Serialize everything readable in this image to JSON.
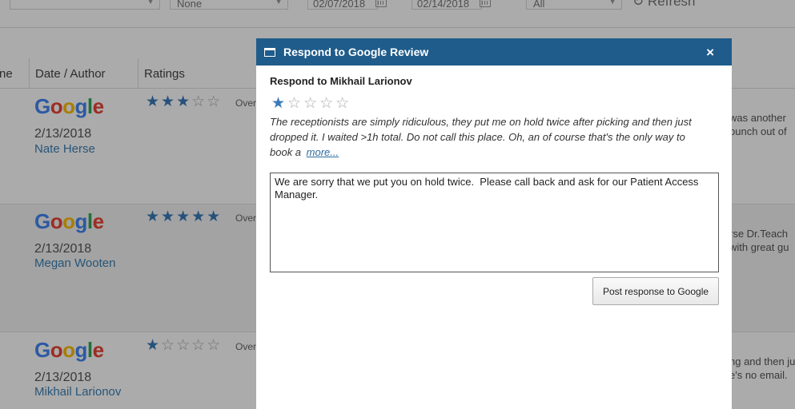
{
  "filters": {
    "select_one": "None",
    "date_from": "02/07/2018",
    "date_to": "02/14/2018",
    "select_two": "All",
    "refresh_label": "Refresh"
  },
  "table": {
    "headers": [
      "ne",
      "Date / Author",
      "Ratings"
    ],
    "rows": [
      {
        "date": "2/13/2018",
        "author": "Nate Herse",
        "stars": "★★★☆☆",
        "over": "Over",
        "text_line1": "was another",
        "text_line2": "bunch out of"
      },
      {
        "date": "2/13/2018",
        "author": "Megan Wooten",
        "stars": "★★★★★",
        "over": "Over",
        "text_line1": "rse Dr.Teach",
        "text_line2": "with great gu"
      },
      {
        "date": "2/13/2018",
        "author": "Mikhail Larionov",
        "stars": "★☆☆☆☆",
        "over": "Over",
        "text_line1": "ng and then ju",
        "text_line2": "e's no email."
      }
    ],
    "logo_letters": [
      "G",
      "o",
      "o",
      "g",
      "l",
      "e"
    ]
  },
  "modal": {
    "title": "Respond to Google Review",
    "close_symbol": "×",
    "respond_to": "Respond to Mikhail Larionov",
    "rating_filled": "★",
    "rating_empty": "☆☆☆☆",
    "review_text": "The receptionists are simply ridiculous, they put me on hold twice after picking and then just dropped it. I waited >1h total. Do not call this place. Oh, an of course that's the only way to book a ",
    "more_link": "more...",
    "response_value": "We are sorry that we put you on hold twice.  Please call back and ask for our Patient Access Manager.",
    "post_button": "Post response to Google"
  },
  "colors": {
    "title_bar": "#1f5c8b",
    "star_filled": "#3a7ab8",
    "author_link": "#3b7fb3"
  },
  "icons": {
    "window": "window-icon",
    "close": "close-icon",
    "calendar": "calendar-icon",
    "refresh": "refresh-icon",
    "star": "star-icon"
  }
}
